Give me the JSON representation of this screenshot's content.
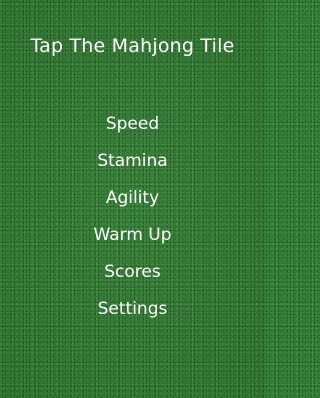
{
  "title": "Tap The Mahjong Tile",
  "menu": {
    "items": [
      {
        "label": "Speed"
      },
      {
        "label": "Stamina"
      },
      {
        "label": "Agility"
      },
      {
        "label": "Warm Up"
      },
      {
        "label": "Scores"
      },
      {
        "label": "Settings"
      }
    ]
  },
  "colors": {
    "background": "#2f7a33",
    "text": "#ffffff"
  }
}
